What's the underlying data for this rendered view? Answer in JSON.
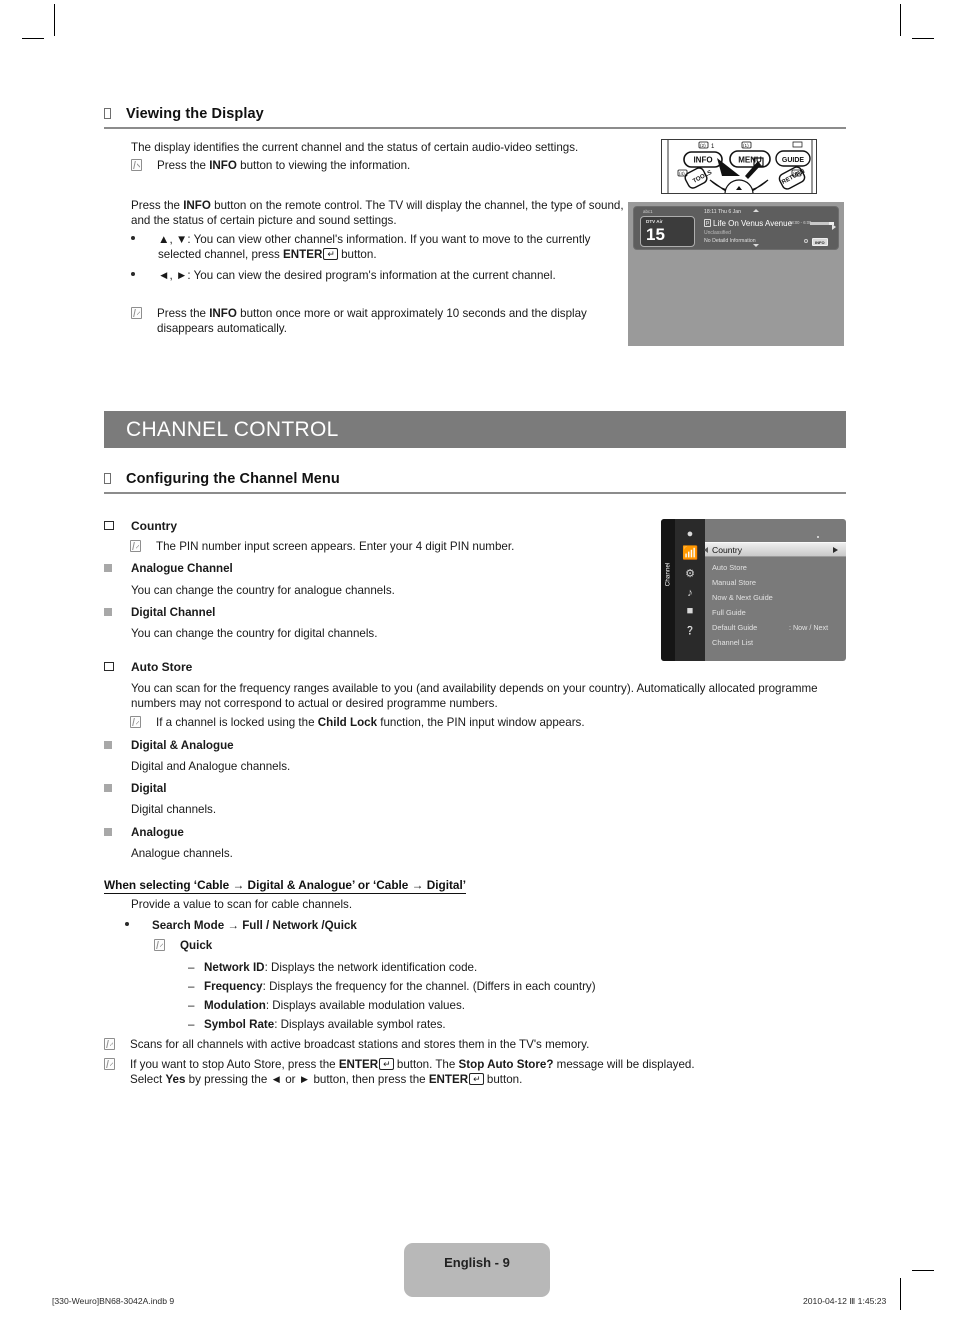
{
  "page": {
    "number_label": "English - 9",
    "footer_left": "[330-Weuro]BN68-3042A.indb   9",
    "footer_right": "2010-04-12   Ⅲ 1:45:23"
  },
  "section_viewing": {
    "heading": "Viewing the Display",
    "intro": "The display identifies the current channel and the status of certain audio-video settings.",
    "note1_a": "Press the ",
    "note1_b": "INFO",
    "note1_c": " button to viewing the information.",
    "para2_a": "Press the ",
    "para2_b": "INFO",
    "para2_c": " button on the remote control. The TV will display the channel, the type of sound, and the status of certain picture and sound settings.",
    "bullet1_a": "▲, ▼: You can view other channel's information. If you want to move to the currently selected channel, press ",
    "bullet1_b": "ENTER",
    "bullet1_c": " button.",
    "bullet2": "◄, ►: You can view the desired program's information at the current channel.",
    "note2_a": "Press the ",
    "note2_b": "INFO",
    "note2_c": " button once more or wait approximately 10 seconds and the display disappears automatically."
  },
  "band": {
    "title": "CHANNEL CONTROL"
  },
  "section_configuring": {
    "heading": "Configuring the Channel Menu"
  },
  "country": {
    "title": "Country",
    "note": "The PIN number input screen appears. Enter your 4 digit PIN number.",
    "sub1_title": "Analogue Channel",
    "sub1_text": "You can change the country for analogue channels.",
    "sub2_title": "Digital Channel",
    "sub2_text": "You can change the country for digital channels."
  },
  "auto_store": {
    "title": "Auto Store",
    "para": "You can scan for the frequency ranges available to you (and availability depends on your country). Automatically allocated programme numbers may not correspond to actual or desired programme numbers.",
    "note_a": "If a channel is locked using the ",
    "note_b": "Child Lock",
    "note_c": " function, the PIN input window appears.",
    "sub1_title": "Digital & Analogue",
    "sub1_text": " Digital and Analogue channels.",
    "sub2_title": "Digital",
    "sub2_text": "Digital channels.",
    "sub3_title": "Analogue",
    "sub3_text": "Analogue channels."
  },
  "cable": {
    "heading": "When selecting ‘Cable → Digital & Analogue’ or ‘Cable → Digital’",
    "lead": "Provide a value to scan for cable channels.",
    "search_mode_a": "Search Mode → Full / Network /Quick",
    "quick_label": "Quick",
    "items": [
      {
        "term": "Network ID",
        "desc": ": Displays the network identification code."
      },
      {
        "term": "Frequency",
        "desc": ": Displays the frequency for the channel. (Differs in each country)"
      },
      {
        "term": "Modulation",
        "desc": ": Displays available modulation values."
      },
      {
        "term": "Symbol Rate",
        "desc": ": Displays available symbol rates."
      }
    ],
    "note1": "Scans for all channels with active broadcast stations and stores them in the TV's memory.",
    "note2_a": "If you want to stop Auto Store, press the ",
    "note2_b": "ENTER",
    "note2_c": " button. The ",
    "note2_d": "Stop Auto Store?",
    "note2_e": " message will be displayed.",
    "note2_f": "Select ",
    "note2_g": "Yes",
    "note2_h": " by pressing the ◄ or ► button, then press the ",
    "note2_i": "ENTER",
    "note2_j": " button."
  },
  "remote_image": {
    "keys": [
      "INFO",
      "MENU",
      "GUIDE",
      "TOOLS",
      "RETURN"
    ]
  },
  "tv_osd": {
    "source": "abc1",
    "channel_label": "DTV Air",
    "channel_number": "15",
    "clock": "18:11 Thu 6 Jan",
    "program_title": "Life On Venus Avenue",
    "rating_badge": "p",
    "classification": "Unclassified",
    "detail": "No Detaild Information",
    "time_range": "18:00 - 6:00",
    "info_key": "INFO"
  },
  "tv_menu": {
    "tab_label": "Channel",
    "icons": [
      "input-icon",
      "antenna-icon",
      "picture-icon",
      "sound-icon",
      "setup-icon",
      "support-icon"
    ],
    "rows": [
      {
        "label": "Country",
        "value": "",
        "active": true
      },
      {
        "label": "Auto Store",
        "value": "",
        "active": false
      },
      {
        "label": "Manual Store",
        "value": "",
        "active": false
      },
      {
        "label": "Now & Next Guide",
        "value": "",
        "active": false
      },
      {
        "label": "Full Guide",
        "value": "",
        "active": false
      },
      {
        "label": "Default Guide",
        "value": ": Now / Next",
        "active": false
      },
      {
        "label": "Channel List",
        "value": "",
        "active": false
      }
    ]
  },
  "colors": {
    "band_bg": "#7b7b7b",
    "rule": "#8c8c8c",
    "badge_bg": "#b8b8b8",
    "tv_bg": "#9a9a9a"
  }
}
